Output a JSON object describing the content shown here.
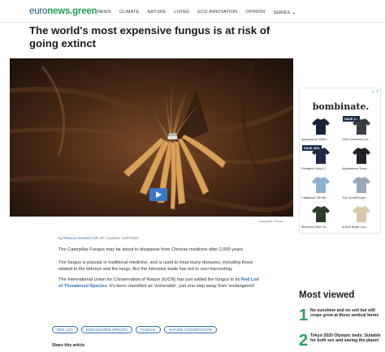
{
  "header": {
    "logo_prefix": "euro",
    "logo_main": "news.green",
    "nav": [
      "NEWS",
      "CLIMATE",
      "NATURE",
      "LIVING",
      "ECO-INNOVATION",
      "OPINION",
      "SERIES"
    ],
    "series_chevron": "⌄"
  },
  "article": {
    "title": "The world's most expensive fungus is at risk of going extinct",
    "image_credit": "Copyright Canva",
    "byline": {
      "prefix": "By",
      "author": "Rebecca Kesevich",
      "with": "with",
      "agency": "AP",
      "updated": "• Updated: 15/07/2020"
    },
    "p1": "The Caterpillar Fungus may be about to disappear from Chinese medicine after 2,000 years.",
    "p2": "The fungus is popular in traditional medicine, and is used to treat many diseases, including those related to the kidneys and the lungs. But the intensive trade has led to over-harvesting.",
    "p3_before": "The International Union for Conservation of Nature (IUCN) has just added the fungus to its ",
    "p3_link": "Red List of Threatened Species",
    "p3_after": ". It's been classified as 'vulnerable', just one step away from 'endangered'.",
    "tags": [
      "RED LIST",
      "ENDANGERED SPECIES",
      "FUNGUS",
      "NATURE CONSERVATION"
    ],
    "share_label": "Share this article"
  },
  "ad": {
    "mark": "▷ ×",
    "brand": "bombinate.",
    "products": [
      {
        "label": "Appearance Midni...",
        "sale": "",
        "color": "#17233a"
      },
      {
        "label": "1931 Charcoal Cot...",
        "sale": "SAVE 2...",
        "color": "#3a3d42"
      },
      {
        "label": "Peregrine Navy E...",
        "sale": "SAVE 30%",
        "color": "#1e2a44"
      },
      {
        "label": "Appearance Deep...",
        "sale": "",
        "color": "#1f2328"
      },
      {
        "label": "Craftsman Off-Wh...",
        "sale": "",
        "color": "#8fb0cf"
      },
      {
        "label": "The GoodPeople...",
        "sale": "",
        "color": "#9aa7b8"
      },
      {
        "label": "Bluemint Olive Ya...",
        "sale": "",
        "color": "#2d3b2a"
      },
      {
        "label": "Artknit Beige Lon...",
        "sale": "",
        "color": "#d8c8a8"
      }
    ]
  },
  "most_viewed": {
    "title": "Most viewed",
    "items": [
      {
        "num": "1",
        "text": "No sunshine and no soil but still crops grow at these vertical farms"
      },
      {
        "num": "2",
        "text": "Tokyo 2020 Olympic beds: Suitable for both sex and saving the planet"
      }
    ]
  }
}
